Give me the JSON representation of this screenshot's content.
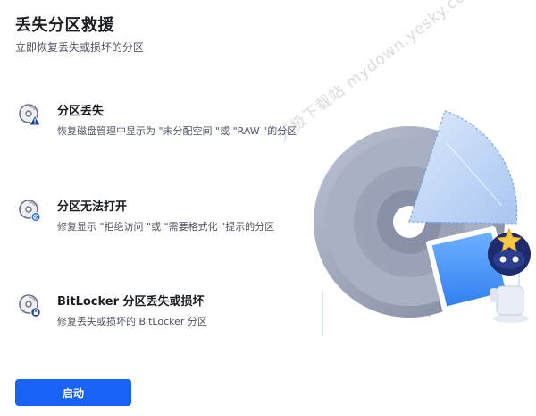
{
  "header": {
    "title": "丢失分区救援",
    "subtitle": "立即恢复丢失或损坏的分区"
  },
  "features": [
    {
      "title": "分区丢失",
      "description": "恢复磁盘管理中显示为 \"未分配空间 \"或 \"RAW \"的分区",
      "icon": "disk-warning-icon"
    },
    {
      "title": "分区无法打开",
      "description": "修复显示 \"拒绝访问 \"或 \"需要格式化 \"提示的分区",
      "icon": "disk-blocked-icon"
    },
    {
      "title": "BitLocker 分区丢失或损坏",
      "description": "修复丢失或损坏的 BitLocker 分区",
      "icon": "disk-lock-icon"
    }
  ],
  "actions": {
    "start_label": "启动"
  },
  "watermark": {
    "text": "天极下载站 mydown.yesky.com"
  },
  "colors": {
    "accent": "#1763f7",
    "warning": "#1b3f9c",
    "disk": "#9aa3b8"
  }
}
